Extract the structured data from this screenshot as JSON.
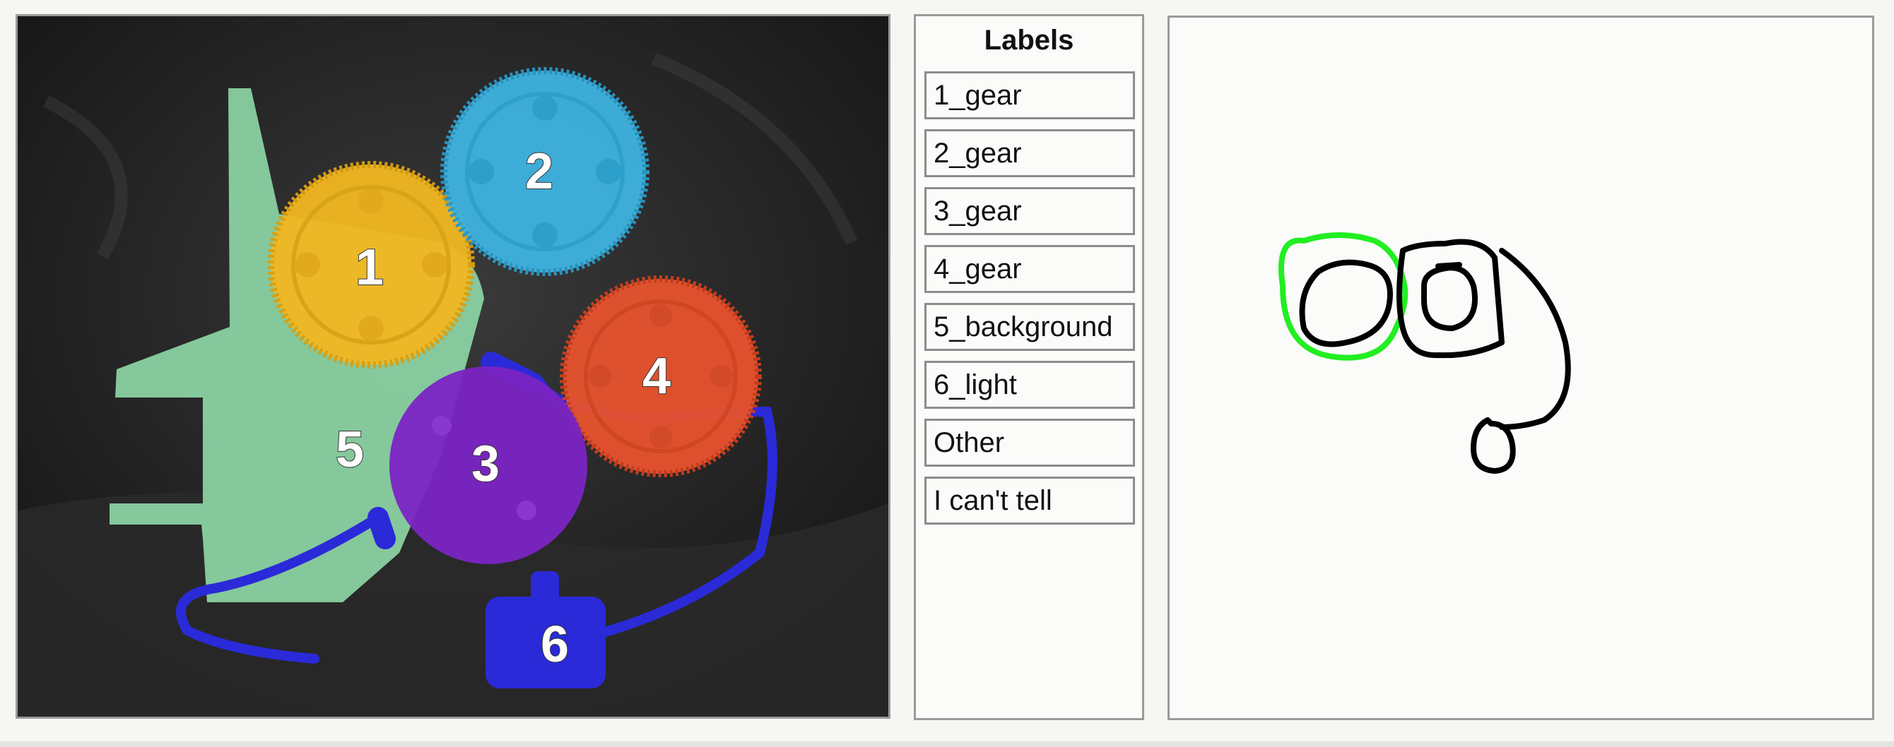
{
  "image_panel": {
    "segments": [
      {
        "number": "1",
        "color": "#f2b821"
      },
      {
        "number": "2",
        "color": "#3eb3e0"
      },
      {
        "number": "3",
        "color": "#7b24c4"
      },
      {
        "number": "4",
        "color": "#e8532e"
      },
      {
        "number": "5",
        "color": "#8fd9a8"
      },
      {
        "number": "6",
        "color": "#2a2ad8"
      }
    ]
  },
  "labels_panel": {
    "title": "Labels",
    "items": [
      "1_gear",
      "2_gear",
      "3_gear",
      "4_gear",
      "5_background",
      "6_light",
      "Other",
      "I can't tell"
    ]
  },
  "sketch_panel": {
    "highlight_color": "#22ee22",
    "stroke_color": "#000000"
  }
}
